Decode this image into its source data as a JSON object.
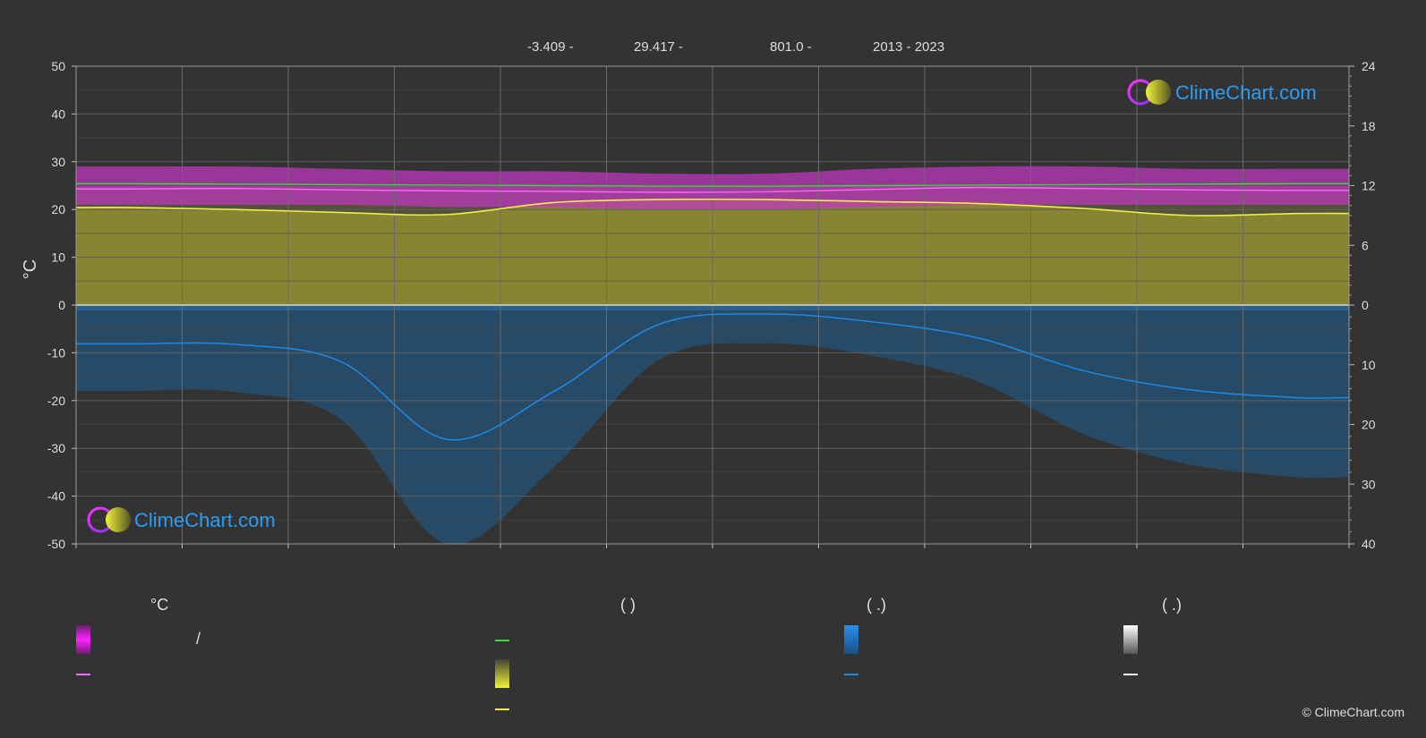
{
  "header": {
    "lat": "-3.409 -",
    "lon": "29.417 -",
    "elev": "801.0 -",
    "years": "2013 - 2023"
  },
  "chart_data": {
    "type": "area",
    "x_months": [
      1,
      2,
      3,
      4,
      5,
      6,
      7,
      8,
      9,
      10,
      11,
      12
    ],
    "left_axis": {
      "label": "°C",
      "range": [
        -50,
        50
      ],
      "ticks": [
        50,
        40,
        30,
        20,
        10,
        0,
        -10,
        -20,
        -30,
        -40,
        -50
      ]
    },
    "right_axis_top": {
      "range": [
        0,
        24
      ],
      "ticks": [
        24,
        18,
        12,
        6,
        0
      ]
    },
    "right_axis_bottom": {
      "range": [
        0,
        40
      ],
      "ticks": [
        10,
        20,
        30,
        40
      ]
    },
    "series": [
      {
        "key": "temp_max",
        "color": "#dd33dd",
        "values": [
          29,
          29,
          28.5,
          28,
          28,
          27.5,
          27.5,
          28.5,
          29,
          29,
          28.5,
          28.5
        ]
      },
      {
        "key": "temp_min",
        "color": "#aa22aa",
        "values": [
          21,
          21,
          21,
          20.5,
          20.5,
          20,
          20,
          20.5,
          21,
          21,
          21,
          21
        ]
      },
      {
        "key": "temp_mean",
        "color": "#ff66ff",
        "values": [
          24.3,
          24.4,
          24.1,
          23.9,
          23.8,
          23.6,
          23.7,
          24.2,
          24.6,
          24.4,
          24.1,
          24.0
        ]
      },
      {
        "key": "daylight",
        "color": "#33dd33",
        "values": [
          12.2,
          12.15,
          12.1,
          12.05,
          12.0,
          11.95,
          11.95,
          12.0,
          12.05,
          12.1,
          12.15,
          12.2
        ]
      },
      {
        "key": "sunshine",
        "color": "#eeee44",
        "values": [
          9.8,
          9.6,
          9.3,
          9.1,
          10.3,
          10.6,
          10.6,
          10.4,
          10.2,
          9.7,
          9.0,
          9.2
        ]
      },
      {
        "key": "precip",
        "color": "#1e88e5",
        "values": [
          6.5,
          6.6,
          9.5,
          22.5,
          14.5,
          3.2,
          1.5,
          2.8,
          5.5,
          11.0,
          14.2,
          15.5
        ]
      }
    ]
  },
  "watermark": {
    "text": "ClimeChart.com"
  },
  "legend": {
    "col1_head": "°C",
    "col1_slash": "/",
    "col2_head": "(            )",
    "col3_head": "(    .)",
    "col4_head": "(    .)"
  },
  "copyright": "© ClimeChart.com"
}
